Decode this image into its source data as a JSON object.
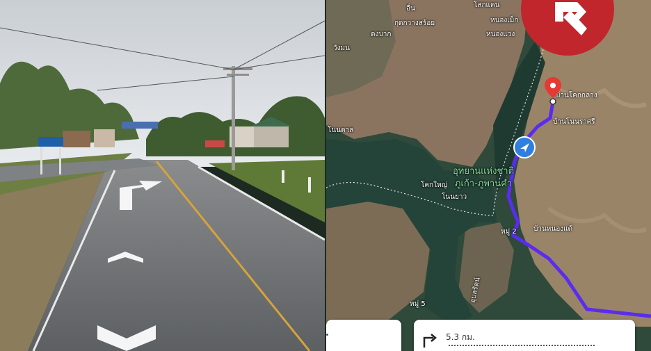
{
  "map": {
    "places": [
      "อื่น",
      "โสกแคน",
      "หนองเม็ก",
      "กุดกวางสร้อย",
      "ดงบาก",
      "หนองแวง",
      "วังมน",
      "บ้านโคกกลาง",
      "บ้านโนนราศรี",
      "โนนตาล",
      "โคกใหญ่",
      "โนนยาว",
      "หมู่ 2",
      "บ้านหนองแต้",
      "อุบลรัตน์",
      "หมู่ 5"
    ],
    "park_line1": "อุทยานแห่งชาติ",
    "park_line2": "ภูเก้า-ภูพานคำ",
    "route_color": "#5a2cf0",
    "logo_color": "#c0262b"
  },
  "directions": {
    "step_distance": "5.3 กม."
  }
}
